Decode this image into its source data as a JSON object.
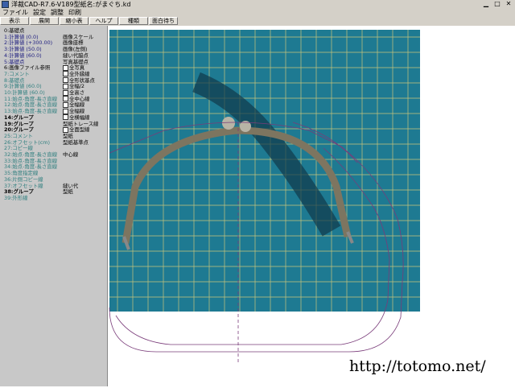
{
  "window": {
    "title": "洋裁CAD-R7.6-V189型紙名:がまぐち.kd"
  },
  "menubar": {
    "items": [
      "ファイル",
      "設定",
      "調整",
      "印刷"
    ]
  },
  "toolbar": {
    "buttons": [
      "表示",
      "展開",
      "縮小表",
      "ヘルプ",
      "種類",
      "面白待ち"
    ]
  },
  "sidebar": {
    "layers": [
      {
        "label": "0:基礎点",
        "right": "",
        "color": "#000000",
        "bold": false
      },
      {
        "label": "1:計算値 (0.0)",
        "right": "画像スケール",
        "color": "#202080",
        "bold": false
      },
      {
        "label": "2:計算値 (+300.00)",
        "right": "画像座標",
        "color": "#202080",
        "bold": false
      },
      {
        "label": "3:計算値 (50.0)",
        "right": "画像(左側)",
        "color": "#202080",
        "bold": false
      },
      {
        "label": "4:計算値 (60.0)",
        "right": "縫い代脇点",
        "color": "#202080",
        "bold": false
      },
      {
        "label": "5:基礎点",
        "right": "写真基礎点",
        "color": "#202080",
        "bold": false
      },
      {
        "label": "6:画像ファイル参照",
        "right": "全写真",
        "color": "#000000",
        "bold": false,
        "checkbox": true
      },
      {
        "label": "7:コメント",
        "right": "全外縁線",
        "color": "#2f7f7f",
        "bold": false,
        "checkbox": true
      },
      {
        "label": "8:基礎点",
        "right": "全形状基点",
        "color": "#2f7f7f",
        "bold": false,
        "checkbox": true
      },
      {
        "label": "9:計算値 (60.0)",
        "right": "全幅/2",
        "color": "#2f7f7f",
        "bold": false,
        "checkbox": true
      },
      {
        "label": "10:計算値 (60.0)",
        "right": "全高さ",
        "color": "#2f7f7f",
        "bold": false,
        "checkbox": true
      },
      {
        "label": "11:始点-角度-長さ直線",
        "right": "全中心線",
        "color": "#2f7f7f",
        "bold": false,
        "checkbox": true
      },
      {
        "label": "12:始点-角度-長さ直線",
        "right": "全幅線",
        "color": "#2f7f7f",
        "bold": false,
        "checkbox": true
      },
      {
        "label": "13:始点-角度-長さ直線",
        "right": "全幅線",
        "color": "#2f7f7f",
        "bold": false,
        "checkbox": true
      },
      {
        "label": "14:グループ",
        "right": "全横幅線",
        "color": "#000000",
        "bold": true,
        "checkbox": true
      },
      {
        "label": "19:グループ",
        "right": "型紙トレース線",
        "color": "#000000",
        "bold": true
      },
      {
        "label": "20:グループ",
        "right": "全面型線",
        "color": "#000000",
        "bold": true,
        "checkbox": true
      },
      {
        "label": "25:コメント",
        "right": "型紙",
        "color": "#2f7f7f",
        "bold": false
      },
      {
        "label": "26:オフセット(cm)",
        "right": "型紙基準点",
        "color": "#2f7f7f",
        "bold": false
      },
      {
        "label": "27:コピー線",
        "right": "",
        "color": "#2f7f7f",
        "bold": false
      },
      {
        "label": "32:始点-角度-長さ直線",
        "right": "中心線",
        "color": "#2f7f7f",
        "bold": false
      },
      {
        "label": "33:始点-角度-長さ直線",
        "right": "",
        "color": "#2f7f7f",
        "bold": false
      },
      {
        "label": "34:始点-角度-長さ直線",
        "right": "",
        "color": "#2f7f7f",
        "bold": false
      },
      {
        "label": "35:角度指定線",
        "right": "",
        "color": "#2f7f7f",
        "bold": false
      },
      {
        "label": "36:片側コピー線",
        "right": "",
        "color": "#2f7f7f",
        "bold": false
      },
      {
        "label": "37:オフセット線",
        "right": "縫い代",
        "color": "#2f7f7f",
        "bold": false
      },
      {
        "label": "38:グループ",
        "right": "型紙",
        "color": "#000000",
        "bold": true
      },
      {
        "label": "39:外形線",
        "right": "",
        "color": "#2f7f7f",
        "bold": false
      }
    ]
  },
  "canvas": {
    "photo_bg": "#1e7a92",
    "grid_color": "#c9c47a",
    "pattern_color": "#7a3c7a",
    "frame_color": "#7d7560"
  },
  "watermark": {
    "text": "http://totomo.net/"
  },
  "icons": {
    "app": "app-icon",
    "minimize": "minimize-icon",
    "maximize": "maximize-icon",
    "close": "close-icon"
  }
}
